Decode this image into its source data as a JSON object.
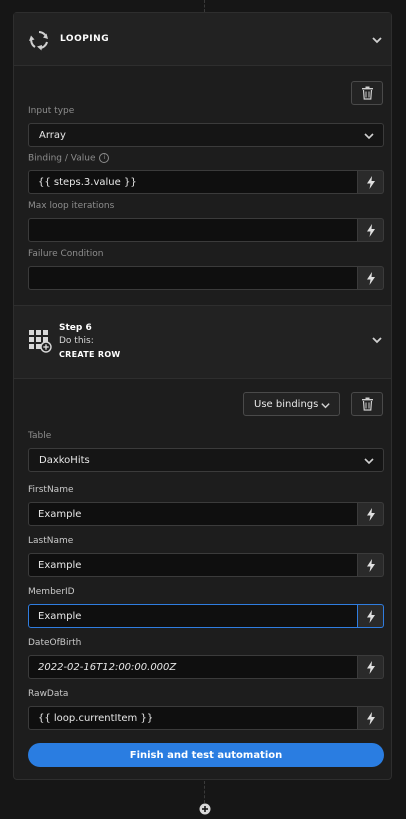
{
  "looping": {
    "title": "LOOPING",
    "input_type_label": "Input type",
    "input_type_value": "Array",
    "binding_label": "Binding / Value",
    "binding_info": "i",
    "binding_value": "{{ steps.3.value }}",
    "max_iter_label": "Max loop iterations",
    "max_iter_value": "",
    "failure_label": "Failure Condition",
    "failure_value": ""
  },
  "step": {
    "number": "Step 6",
    "do_this": "Do this:",
    "action": "CREATE ROW",
    "bindings_button": "Use bindings",
    "table_label": "Table",
    "table_value": "DaxkoHits",
    "fields": [
      {
        "label": "FirstName",
        "value": "Example"
      },
      {
        "label": "LastName",
        "value": "Example"
      },
      {
        "label": "MemberID",
        "value": "Example"
      },
      {
        "label": "DateOfBirth",
        "value": "2022-02-16T12:00:00.000Z"
      },
      {
        "label": "RawData",
        "value": "{{ loop.currentItem }}"
      }
    ]
  },
  "finish_button": "Finish and test automation",
  "colors": {
    "accent": "#2a7de1",
    "background": "#161616",
    "panel": "#1d1d1d"
  },
  "icons": [
    "loop-icon",
    "chevron-down-icon",
    "trash-icon",
    "lightning-icon",
    "table-add-icon",
    "plus-circle-icon"
  ]
}
